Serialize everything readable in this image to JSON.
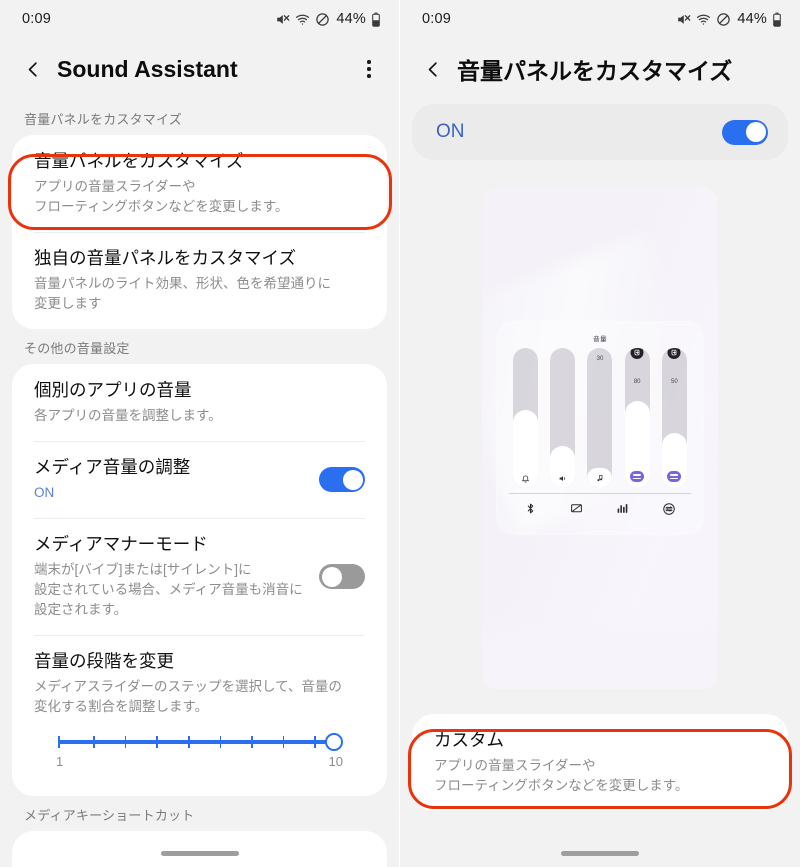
{
  "status_bar": {
    "time": "0:09",
    "battery_text": "44%",
    "icons": [
      "mute-icon",
      "wifi-icon",
      "do-not-disturb-icon",
      "battery-icon"
    ]
  },
  "left_screen": {
    "app_bar": {
      "back": "back-arrow",
      "title": "Sound Assistant",
      "overflow": "more-options"
    },
    "sections": [
      {
        "header": "音量パネルをカスタマイズ",
        "rows": [
          {
            "title": "音量パネルをカスタマイズ",
            "subtitle": "アプリの音量スライダーや\nフローティングボタンなどを変更します。",
            "highlighted": true
          },
          {
            "title": "独自の音量パネルをカスタマイズ",
            "subtitle": "音量パネルのライト効果、形状、色を希望通りに\n変更します"
          }
        ]
      },
      {
        "header": "その他の音量設定",
        "rows": [
          {
            "title": "個別のアプリの音量",
            "subtitle": "各アプリの音量を調整します。"
          },
          {
            "title": "メディア音量の調整",
            "subtitle": "ON",
            "toggle": "on"
          },
          {
            "title": "メディアマナーモード",
            "subtitle": "端末が[バイブ]または[サイレント]に\n設定されている場合、メディア音量も消音に\n設定されます。",
            "toggle": "off"
          },
          {
            "title": "音量の段階を変更",
            "subtitle": "メディアスライダーのステップを選択して、音量の\n変化する割合を調整します。",
            "slider": {
              "min_label": "1",
              "max_label": "10",
              "value": 10,
              "steps": 10,
              "accent": "#2a6ff0"
            }
          }
        ]
      },
      {
        "header": "メディアキーショートカット",
        "rows": []
      }
    ]
  },
  "right_screen": {
    "app_bar": {
      "back": "back-arrow",
      "title": "音量パネルをカスタマイズ"
    },
    "master_toggle": {
      "label": "ON",
      "state": "on"
    },
    "preview": {
      "panel_title": "音量",
      "sliders": [
        {
          "icon": "bell-icon",
          "value": null,
          "fill_pct": 56,
          "locked": false,
          "chip": false
        },
        {
          "icon": "speaker-icon",
          "value": null,
          "fill_pct": 30,
          "locked": false,
          "chip": false
        },
        {
          "icon": "music-note-icon",
          "value": "30",
          "fill_pct": 14,
          "locked": false,
          "chip": false
        },
        {
          "icon": "equalizer-chip-icon",
          "value": "80",
          "fill_pct": 62,
          "locked": true,
          "chip": true
        },
        {
          "icon": "equalizer-chip-icon",
          "value": "50",
          "fill_pct": 39,
          "locked": true,
          "chip": true
        }
      ],
      "bottom_icons": [
        "bluetooth-icon",
        "cast-off-icon",
        "equalizer-bars-icon",
        "sound-settings-icon"
      ]
    },
    "bottom_option": {
      "title": "カスタム",
      "subtitle": "アプリの音量スライダーや\nフローティングボタンなどを変更します。",
      "highlighted": true
    }
  },
  "theme": {
    "accent_blue": "#2a6ff0",
    "highlight_red": "#e8340c",
    "screen_bg": "#f2f2f2",
    "card_bg": "#ffffff",
    "on_text_blue": "#3c63c4"
  }
}
